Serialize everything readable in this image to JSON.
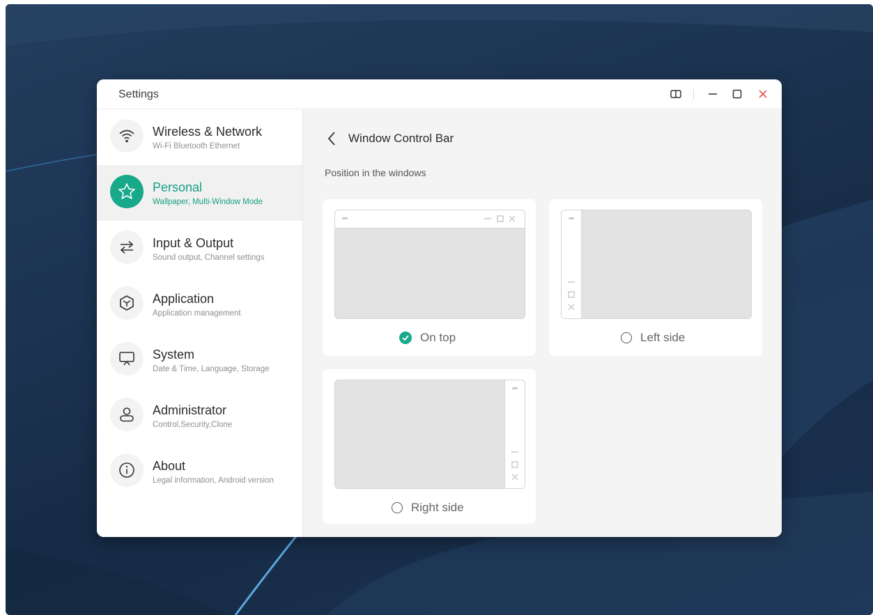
{
  "window": {
    "title": "Settings"
  },
  "sidebar": {
    "items": [
      {
        "label": "Wireless & Network",
        "sublabel": "Wi-Fi Bluetooth Ethernet",
        "icon": "wifi-icon",
        "active": false
      },
      {
        "label": "Personal",
        "sublabel": "Wallpaper, Multi-Window Mode",
        "icon": "star-icon",
        "active": true
      },
      {
        "label": "Input & Output",
        "sublabel": "Sound output, Channel settings",
        "icon": "swap-arrows-icon",
        "active": false
      },
      {
        "label": "Application",
        "sublabel": "Application management",
        "icon": "cube-icon",
        "active": false
      },
      {
        "label": "System",
        "sublabel": "Date & Time, Language, Storage",
        "icon": "presentation-icon",
        "active": false
      },
      {
        "label": "Administrator",
        "sublabel": "Control,Security,Clone",
        "icon": "user-icon",
        "active": false
      },
      {
        "label": "About",
        "sublabel": "Legal information, Android version",
        "icon": "info-icon",
        "active": false
      }
    ]
  },
  "content": {
    "title": "Window Control Bar",
    "section_label": "Position in the windows",
    "options": [
      {
        "label": "On top",
        "selected": true
      },
      {
        "label": "Left side",
        "selected": false
      },
      {
        "label": "Right side",
        "selected": false
      }
    ]
  },
  "colors": {
    "accent": "#18a98b",
    "close": "#e5534b",
    "desktop": "#1c3452"
  }
}
